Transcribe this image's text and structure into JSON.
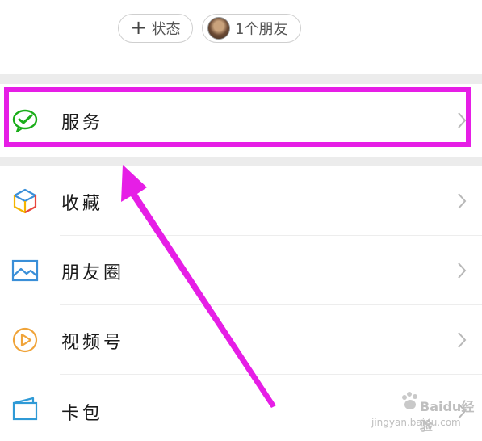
{
  "status_row": {
    "add_status_label": "状态",
    "friends_label": "1个朋友"
  },
  "menu": [
    {
      "label": "服务",
      "icon": "wechat-pay-service-icon",
      "color": "#1aad19"
    },
    {
      "label": "收藏",
      "icon": "favorites-cube-icon",
      "color": "#f4b400"
    },
    {
      "label": "朋友圈",
      "icon": "moments-image-icon",
      "color": "#3a8fd8"
    },
    {
      "label": "视频号",
      "icon": "channels-play-icon",
      "color": "#f0a43a"
    },
    {
      "label": "卡包",
      "icon": "card-wallet-icon",
      "color": "#2f9ad6"
    }
  ],
  "annotation": {
    "highlight_color": "#e61ee6"
  },
  "watermark": {
    "brand": "Baidu经验",
    "url": "jingyan.baidu.com"
  }
}
